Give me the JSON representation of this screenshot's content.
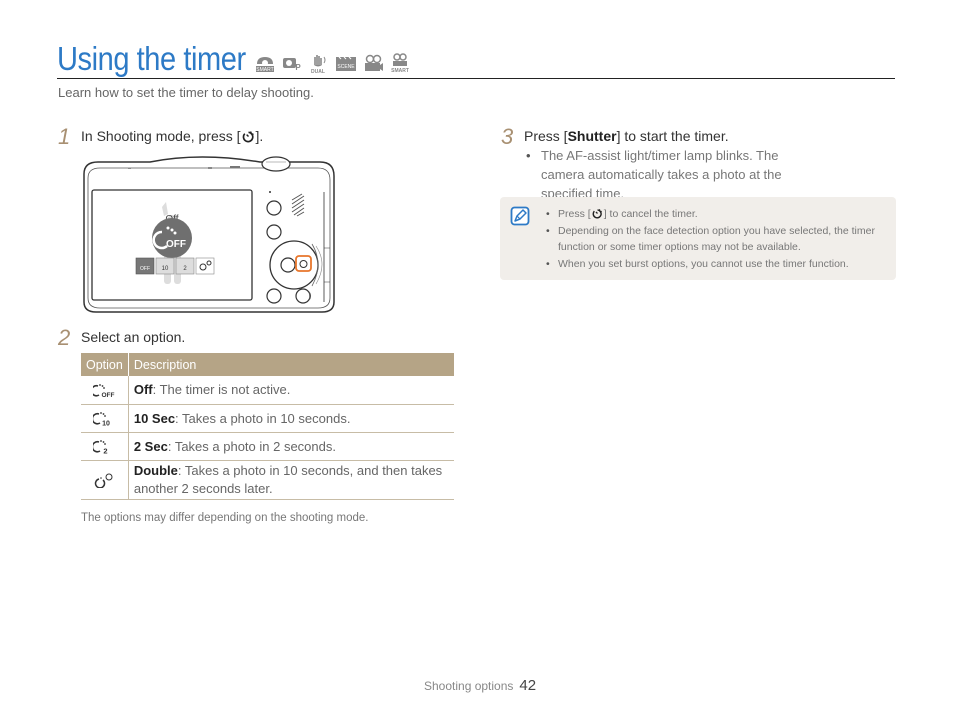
{
  "header": {
    "title": "Using the timer",
    "mode_icons": [
      "smart-auto-mode-icon",
      "program-mode-icon",
      "dual-is-mode-icon",
      "scene-mode-icon",
      "movie-mode-icon",
      "smart-movie-mode-icon"
    ],
    "mode_icon_labels": [
      "SMART",
      "P",
      "DUAL",
      "SCENE",
      "",
      "SMART"
    ],
    "subtitle": "Learn how to set the timer to delay shooting."
  },
  "steps": [
    {
      "number": "1",
      "text_before": "In Shooting mode, press [",
      "icon": "timer-icon",
      "text_after": "]."
    },
    {
      "number": "2",
      "text": "Select an option."
    },
    {
      "number": "3",
      "text_before": "Press [",
      "bold": "Shutter",
      "text_after": "] to start the timer.",
      "bullets": [
        "The AF-assist light/timer lamp blinks. The camera automatically takes a photo at the specified time."
      ]
    }
  ],
  "camera_screen": {
    "selected_label": "Off",
    "selected_icon_text": "OFF",
    "option_icons": [
      "timer-off-icon",
      "timer-10sec-icon",
      "timer-2sec-icon",
      "timer-double-icon"
    ],
    "highlighted_button": "timer-button"
  },
  "options_table": {
    "headers": [
      "Option",
      "Description"
    ],
    "rows": [
      {
        "icon": "timer-off-icon",
        "name": "Off",
        "description": ": The timer is not active."
      },
      {
        "icon": "timer-10sec-icon",
        "name": "10 Sec",
        "description": ": Takes a photo in 10 seconds."
      },
      {
        "icon": "timer-2sec-icon",
        "name": "2 Sec",
        "description": ": Takes a photo in 2 seconds."
      },
      {
        "icon": "timer-double-icon",
        "name": "Double",
        "description": ": Takes a photo in 10 seconds, and then takes another 2 seconds later."
      }
    ],
    "footnote": "The options may differ depending on the shooting mode."
  },
  "note": {
    "icon": "note-pencil-icon",
    "items": [
      {
        "before": "Press [",
        "icon": "timer-icon",
        "after": "] to cancel the timer."
      },
      {
        "text": "Depending on the face detection option you have selected, the timer function or some timer options may not be available."
      },
      {
        "text": "When you set burst options, you cannot use the timer function."
      }
    ]
  },
  "footer": {
    "section": "Shooting options",
    "page": "42"
  },
  "colors": {
    "title": "#2d7ac6",
    "step_number": "#a89072",
    "table_header": "#b5a486",
    "note_bg": "#f1eeea",
    "highlight": "#e8762b"
  }
}
